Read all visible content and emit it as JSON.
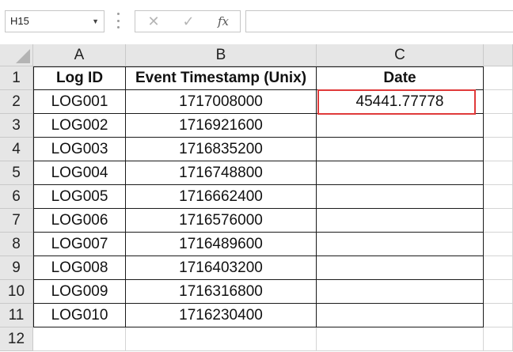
{
  "formula_bar": {
    "name_box": "H15",
    "cancel_icon": "✕",
    "enter_icon": "✓",
    "fx_label": "fx",
    "formula": ""
  },
  "columns": [
    "A",
    "B",
    "C"
  ],
  "rows": [
    "1",
    "2",
    "3",
    "4",
    "5",
    "6",
    "7",
    "8",
    "9",
    "10",
    "11",
    "12"
  ],
  "table": {
    "headers": [
      "Log ID",
      "Event Timestamp (Unix)",
      "Date"
    ],
    "data": [
      [
        "LOG001",
        "1717008000",
        "45441.77778"
      ],
      [
        "LOG002",
        "1716921600",
        ""
      ],
      [
        "LOG003",
        "1716835200",
        ""
      ],
      [
        "LOG004",
        "1716748800",
        ""
      ],
      [
        "LOG005",
        "1716662400",
        ""
      ],
      [
        "LOG006",
        "1716576000",
        ""
      ],
      [
        "LOG007",
        "1716489600",
        ""
      ],
      [
        "LOG008",
        "1716403200",
        ""
      ],
      [
        "LOG009",
        "1716316800",
        ""
      ],
      [
        "LOG010",
        "1716230400",
        ""
      ]
    ]
  },
  "colors": {
    "highlight_border": "#e03a3a",
    "header_bg": "#e6e6e6",
    "gridline": "#d4d4d4"
  }
}
